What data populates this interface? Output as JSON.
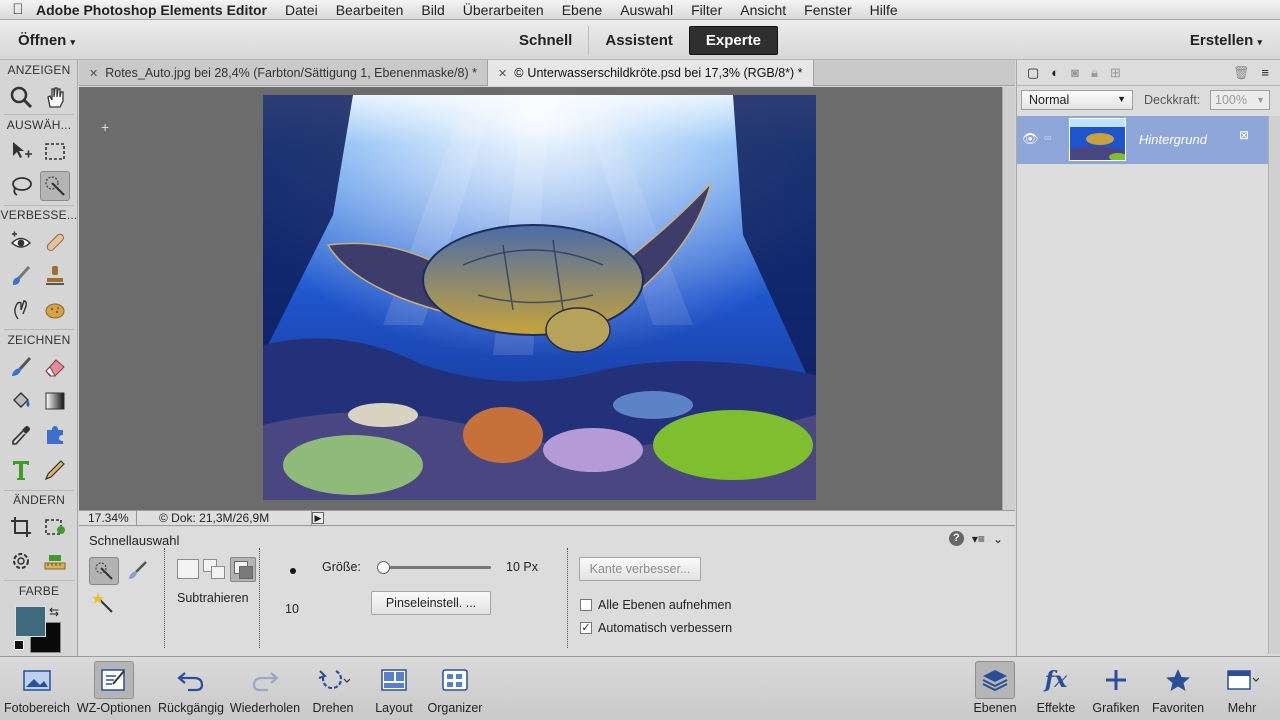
{
  "menubar": {
    "app_name": "Adobe Photoshop Elements Editor",
    "items": [
      "Datei",
      "Bearbeiten",
      "Bild",
      "Überarbeiten",
      "Ebene",
      "Auswahl",
      "Filter",
      "Ansicht",
      "Fenster",
      "Hilfe"
    ]
  },
  "topbar": {
    "open_label": "Öffnen",
    "create_label": "Erstellen",
    "modes": [
      "Schnell",
      "Assistent",
      "Experte"
    ],
    "active_mode": "Experte"
  },
  "toolbox": {
    "sections": {
      "view": "ANZEIGEN",
      "select": "AUSWÄH...",
      "enhance": "VERBESSE...",
      "draw": "ZEICHNEN",
      "modify": "ÄNDERN",
      "color": "FARBE"
    },
    "foreground_color": "#3f6a7d",
    "background_color": "#0a0a0a"
  },
  "tabs": [
    {
      "title": "Rotes_Auto.jpg bei 28,4% (Farbton/Sättigung 1, Ebenenmaske/8) *",
      "active": false
    },
    {
      "title": "Unterwasserschildkröte.psd bei 17,3% (RGB/8*) *",
      "active": true
    }
  ],
  "status": {
    "zoom": "17.34%",
    "doc": "© Dok: 21,3M/26,9M"
  },
  "tool_options": {
    "title": "Schnellauswahl",
    "mode_label": "Subtrahieren",
    "size_label": "Größe:",
    "size_value": "10 Px",
    "size_fraction": 0.0,
    "brush_size": "10",
    "brush_settings_label": "Pinseleinstell. ...",
    "refine_edge_label": "Kante verbesser...",
    "sample_all_layers": {
      "label": "Alle Ebenen aufnehmen",
      "checked": false
    },
    "auto_enhance": {
      "label": "Automatisch verbessern",
      "checked": true
    }
  },
  "layers_panel": {
    "blend_mode": "Normal",
    "opacity_label": "Deckkraft:",
    "opacity_value": "100%",
    "layer_name": "Hintergrund"
  },
  "bottombar": {
    "left": [
      "Fotobereich",
      "WZ-Optionen",
      "Rückgängig",
      "Wiederholen",
      "Drehen",
      "Layout",
      "Organizer"
    ],
    "right": [
      "Ebenen",
      "Effekte",
      "Grafiken",
      "Favoriten",
      "Mehr"
    ]
  }
}
